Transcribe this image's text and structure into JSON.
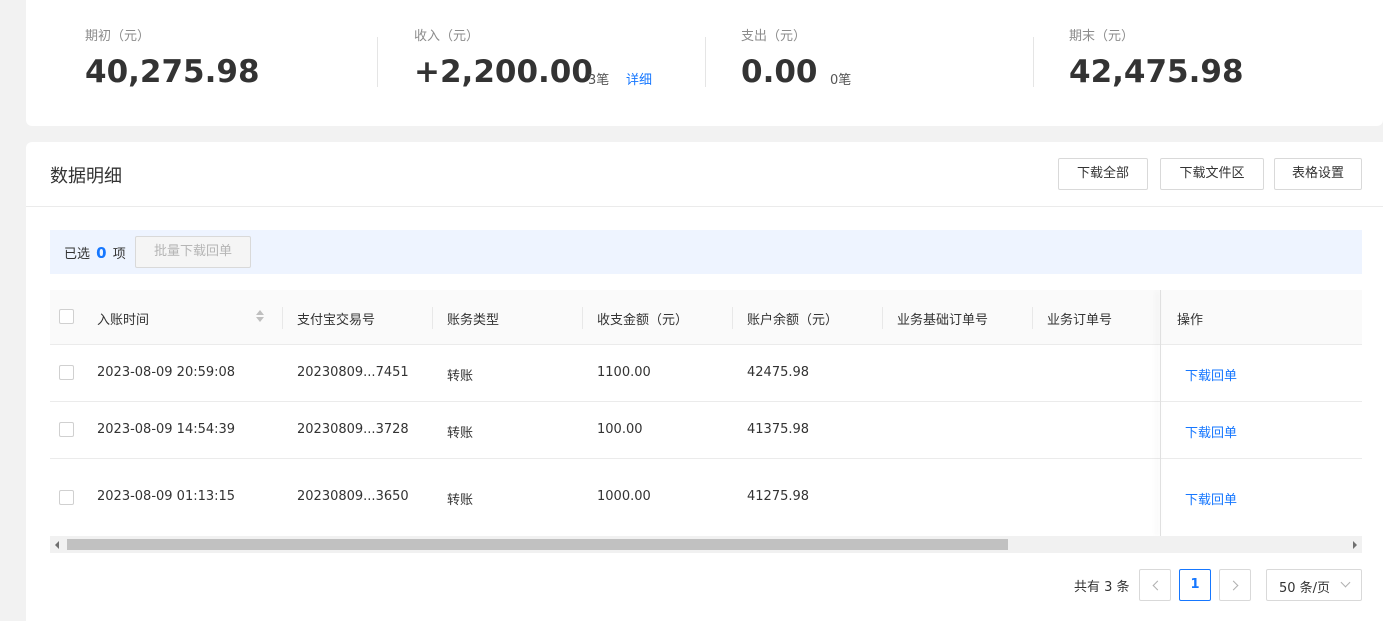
{
  "summary": {
    "opening": {
      "label": "期初（元）",
      "value": "40,275.98"
    },
    "income": {
      "label": "收入（元）",
      "value": "+2,200.00",
      "count": "3笔",
      "detail_link": "详细"
    },
    "expense": {
      "label": "支出（元）",
      "value": "0.00",
      "count": "0笔"
    },
    "closing": {
      "label": "期末（元）",
      "value": "42,475.98"
    }
  },
  "detail": {
    "title": "数据明细",
    "buttons": {
      "download_all": "下载全部",
      "download_area": "下载文件区",
      "table_settings": "表格设置"
    }
  },
  "selection": {
    "prefix": "已选",
    "count": "0",
    "suffix": "项",
    "batch_button": "批量下载回单"
  },
  "table": {
    "columns": [
      "入账时间",
      "支付宝交易号",
      "账务类型",
      "收支金额（元）",
      "账户余额（元）",
      "业务基础订单号",
      "业务订单号",
      "操作"
    ],
    "rows": [
      {
        "time": "2023-08-09 20:59:08",
        "trade_no": "20230809...7451",
        "type": "转账",
        "amount": "1100.00",
        "balance": "42475.98",
        "action": "下载回单"
      },
      {
        "time": "2023-08-09 14:54:39",
        "trade_no": "20230809...3728",
        "type": "转账",
        "amount": "100.00",
        "balance": "41375.98",
        "action": "下载回单"
      },
      {
        "time": "2023-08-09 01:13:15",
        "trade_no": "20230809...3650",
        "type": "转账",
        "amount": "1000.00",
        "balance": "41275.98",
        "action": "下载回单"
      }
    ]
  },
  "pagination": {
    "total": "共有 3 条",
    "current_page": "1",
    "page_size": "50 条/页"
  },
  "colors": {
    "accent": "#1677ff",
    "selection_bar": "#eef4ff",
    "background": "#f2f2f2"
  }
}
